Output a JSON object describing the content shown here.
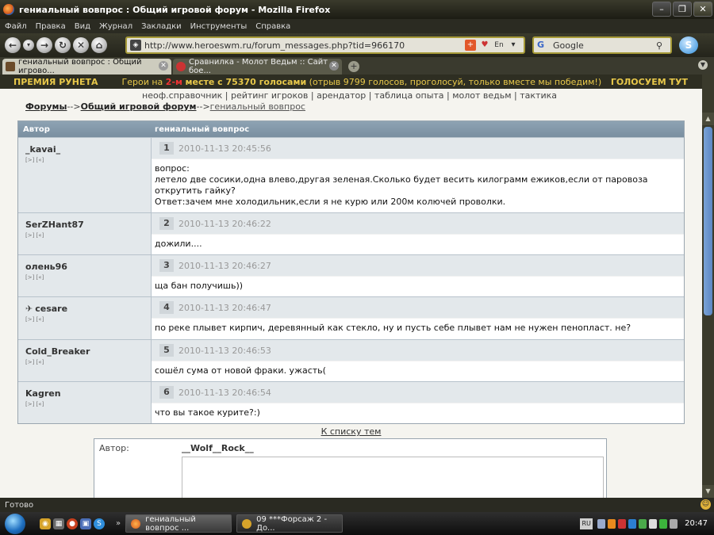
{
  "window": {
    "title": "гениальный вовпрос : Общий игровой форум - Mozilla Firefox"
  },
  "menu": [
    "Файл",
    "Правка",
    "Вид",
    "Журнал",
    "Закладки",
    "Инструменты",
    "Справка"
  ],
  "nav": {
    "url": "http://www.heroeswm.ru/forum_messages.php?tid=966170",
    "search_placeholder": "Google",
    "url_icon_lang": "En"
  },
  "tabs": [
    {
      "label": "гениальный вовпрос : Общий игрово..."
    },
    {
      "label": "Сравнилка - Молот Ведьм :: Сайт бое..."
    }
  ],
  "banner": {
    "left": "ПРЕМИЯ РУНЕТА",
    "mid_prefix": "Герои на",
    "place": "2-м",
    "mid_bold": "месте с 75370 голосами",
    "mid_suffix": "(отрыв 9799 голосов, проголосуй, только вместе мы победим!)",
    "right": "ГОЛОСУЕМ ТУТ"
  },
  "toplinks": "неоф.справочник | рейтинг игроков | арендатор | таблица опыта | молот ведьм | тактика",
  "breadcrumb": {
    "forums": "Форумы",
    "sep1": "-->",
    "section": "Общий игровой форум",
    "sep2": "-->",
    "topic": "гениальный вовпрос"
  },
  "table": {
    "col_author": "Автор",
    "col_topic": "гениальный вовпрос",
    "mini_links": "[>] [«]",
    "posts": [
      {
        "author": "_kavai_",
        "num": "1",
        "date": "2010-11-13 20:45:56",
        "lines": [
          "вопрос:",
          "летело две сосики,одна влево,другая зеленая.Сколько будет весить килограмм ежиков,если от паровоза",
          "открутить гайку?",
          "Ответ:зачем мне холодильник,если я не курю или 200м колючей проволки."
        ]
      },
      {
        "author": "SerZHant87",
        "num": "2",
        "date": "2010-11-13 20:46:22",
        "lines": [
          "дожили...."
        ]
      },
      {
        "author": "олень96",
        "num": "3",
        "date": "2010-11-13 20:46:27",
        "lines": [
          "ща бан получишь))"
        ]
      },
      {
        "author": "cesare",
        "num": "4",
        "date": "2010-11-13 20:46:47",
        "lines": [
          "по реке плывет кирпич, деревянный как стекло, ну и пусть себе плывет нам не нужен пенопласт. не?"
        ]
      },
      {
        "author": "Cold_Breaker",
        "num": "5",
        "date": "2010-11-13 20:46:53",
        "lines": [
          "сошёл сума от новой фраки. ужасть("
        ]
      },
      {
        "author": "Kagren",
        "num": "6",
        "date": "2010-11-13 20:46:54",
        "lines": [
          "что вы такое курите?:)"
        ]
      }
    ]
  },
  "back_link": "К списку тем",
  "reply": {
    "label": "Автор:",
    "author": "__Wolf__Rock__"
  },
  "status": "Готово",
  "taskbar": {
    "tasks": [
      {
        "label": "гениальный вовпрос ..."
      },
      {
        "label": "09 ***Форсаж 2 - До..."
      }
    ],
    "lang": "RU",
    "clock": "20:47"
  },
  "colors": {
    "banner_text": "#e8c84a",
    "banner_place": "#e33333",
    "table_header": "#8ea3b3",
    "scroll_thumb": "#6a95cd"
  }
}
